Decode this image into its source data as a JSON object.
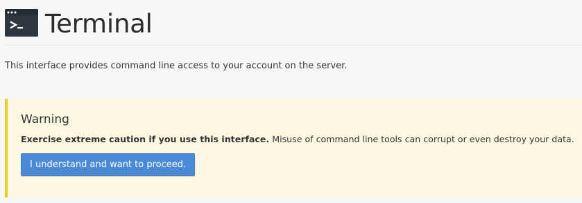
{
  "page": {
    "title": "Terminal",
    "description": "This interface provides command line access to your account on the server.",
    "icon": "terminal-icon"
  },
  "warning": {
    "title": "Warning",
    "strong_text": "Exercise extreme caution if you use this interface.",
    "text": " Misuse of command line tools can corrupt or even destroy your data.",
    "button_label": "I understand and want to proceed."
  },
  "colors": {
    "page_background": "#f8f8f8",
    "warning_background": "#fcf8e1",
    "warning_border": "#f0c92b",
    "button_background": "#4a89d6",
    "icon_background": "#2f3640"
  }
}
